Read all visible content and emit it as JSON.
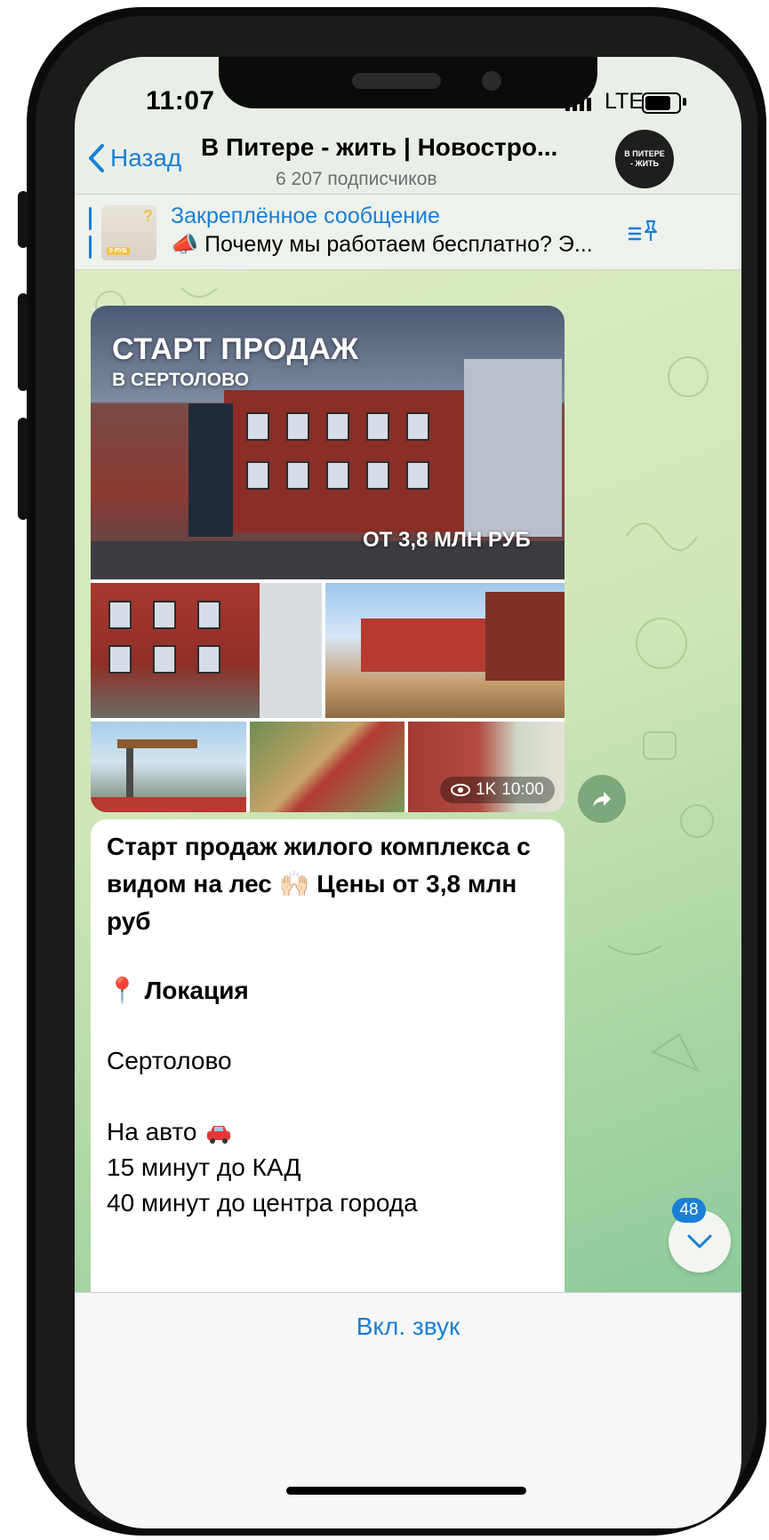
{
  "status_bar": {
    "time": "11:07",
    "network": "LTE"
  },
  "nav": {
    "back_label": "Назад",
    "title": "В Питере - жить | Новостро...",
    "subscribers": "6 207 подписчиков",
    "avatar_text": "В ПИТЕРЕ - ЖИТЬ"
  },
  "pinned": {
    "label": "Закреплённое сообщение",
    "text": "📣 Почему мы работаем бесплатно? Э...",
    "thumb_badge": "0 РУБ"
  },
  "album": {
    "title": "СТАРТ ПРОДАЖ",
    "subtitle": "В СЕРТОЛОВО",
    "price": "ОТ 3,8 МЛН РУБ",
    "views": "1K",
    "time": "10:00"
  },
  "message": {
    "headline": "Старт продаж жилого комплекса с видом на лес 🙌🏻 Цены от 3,8 млн руб",
    "location_label": "📍 Локация",
    "location": "Сертолово",
    "by_car": "На авто",
    "line1": "15 минут до КАД",
    "line2": "40 минут до центра города"
  },
  "scroll": {
    "unread_count": "48"
  },
  "bottom": {
    "unmute_label": "Вкл. звук"
  },
  "colors": {
    "accent": "#1a7fd6",
    "bubble": "#ffffff"
  }
}
